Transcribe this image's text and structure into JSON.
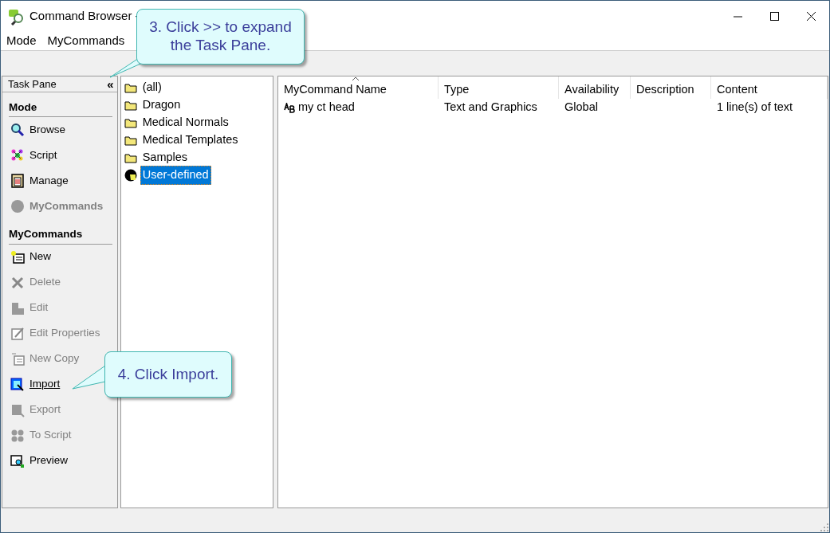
{
  "window": {
    "title": "Command Browser -"
  },
  "menu": [
    {
      "label": "Mode"
    },
    {
      "label": "MyCommands"
    }
  ],
  "task_pane": {
    "title": "Task Pane",
    "collapse": "«",
    "sections": [
      {
        "title": "Mode",
        "items": [
          {
            "label": "Browse",
            "kind": "browse",
            "disabled": false,
            "hovered": false
          },
          {
            "label": "Script",
            "kind": "script",
            "disabled": false,
            "hovered": false
          },
          {
            "label": "Manage",
            "kind": "manage",
            "disabled": false,
            "hovered": false
          },
          {
            "label": "MyCommands",
            "kind": "mycommands",
            "disabled": true,
            "bold": true,
            "hovered": false
          }
        ]
      },
      {
        "title": "MyCommands",
        "items": [
          {
            "label": "New",
            "kind": "new",
            "disabled": false,
            "hovered": false
          },
          {
            "label": "Delete",
            "kind": "delete",
            "disabled": true,
            "hovered": false
          },
          {
            "label": "Edit",
            "kind": "edit",
            "disabled": true,
            "hovered": false
          },
          {
            "label": "Edit Properties",
            "kind": "properties",
            "disabled": true,
            "hovered": false
          },
          {
            "label": "New Copy",
            "kind": "copy",
            "disabled": true,
            "hovered": false
          },
          {
            "label": "Import",
            "kind": "import",
            "disabled": false,
            "hovered": true
          },
          {
            "label": "Export",
            "kind": "export",
            "disabled": true,
            "hovered": false
          },
          {
            "label": "To Script",
            "kind": "toscript",
            "disabled": true,
            "hovered": false
          },
          {
            "label": "Preview",
            "kind": "preview",
            "disabled": false,
            "hovered": false
          }
        ]
      }
    ]
  },
  "groups": [
    {
      "label": "(all)",
      "kind": "folder",
      "selected": false
    },
    {
      "label": "Dragon",
      "kind": "folder",
      "selected": false
    },
    {
      "label": "Medical Normals",
      "kind": "folder",
      "selected": false
    },
    {
      "label": "Medical Templates",
      "kind": "folder",
      "selected": false
    },
    {
      "label": "Samples",
      "kind": "folder",
      "selected": false
    },
    {
      "label": "User-defined",
      "kind": "user",
      "selected": true
    }
  ],
  "table": {
    "columns": [
      {
        "label": "MyCommand Name",
        "sorted": true
      },
      {
        "label": "Type",
        "sorted": false
      },
      {
        "label": "Availability",
        "sorted": false
      },
      {
        "label": "Description",
        "sorted": false
      },
      {
        "label": "Content",
        "sorted": false
      }
    ],
    "rows": [
      {
        "cells": [
          "my ct head",
          "Text and Graphics",
          "Global",
          "",
          "1 line(s) of text"
        ],
        "selected": false
      }
    ]
  },
  "callouts": [
    {
      "text": "3. Click >> to expand the Task Pane."
    },
    {
      "text": "4. Click Import."
    }
  ]
}
